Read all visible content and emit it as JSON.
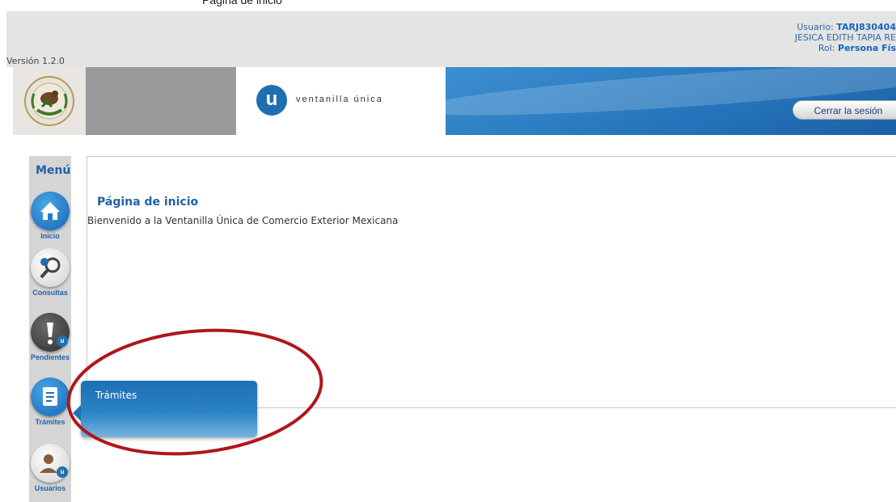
{
  "top_text": "Página de inicio",
  "header": {
    "version": "Versión 1.2.0",
    "user_label": "Usuario:",
    "user_id": "TARJ830404",
    "user_name": "JESICA EDITH TAPIA RE",
    "role_label": "Rol:",
    "role_value": "Persona Fís"
  },
  "banner": {
    "logo_letter": "u",
    "logo_text": "ventanilla única",
    "logout_label": "Cerrar la sesión",
    "accent_color": "#1f6fb0"
  },
  "menu": {
    "title": "Menú",
    "items": [
      {
        "label": "Inicio",
        "icon": "home-icon"
      },
      {
        "label": "Consultas",
        "icon": "magnifier-icon"
      },
      {
        "label": "Pendientes",
        "icon": "alert-icon"
      },
      {
        "label": "Trámites",
        "icon": "document-icon"
      },
      {
        "label": "Usuarios",
        "icon": "user-icon"
      }
    ]
  },
  "main": {
    "title": "Página de inicio",
    "welcome": "Bienvenido a la Ventanilla Única de Comercio Exterior Mexicana"
  },
  "flyout": {
    "item": "Trámites"
  },
  "annotation_color": "#b0161c"
}
